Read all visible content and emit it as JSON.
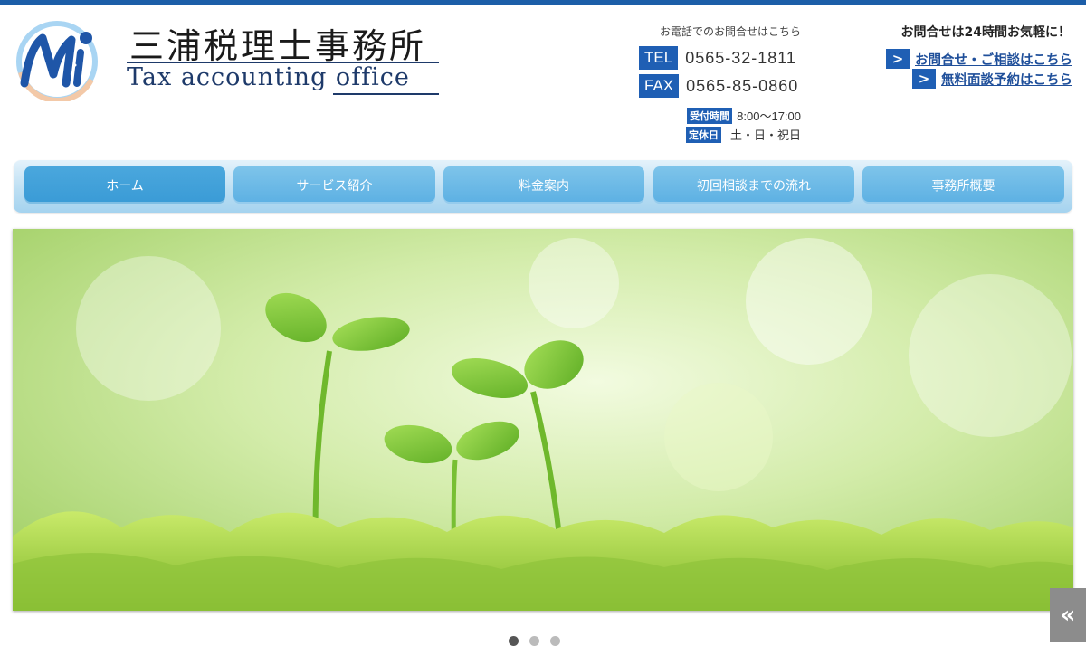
{
  "header": {
    "logo_title": "三浦税理士事務所",
    "logo_subtitle": "Tax accounting office"
  },
  "phone": {
    "caption": "お電話でのお問合せはこちら",
    "tel_label": "TEL",
    "tel_number": "0565-32-1811",
    "fax_label": "FAX",
    "fax_number": "0565-85-0860",
    "hours_label": "受付時間",
    "hours_value": "8:00〜17:00",
    "closed_label": "定休日",
    "closed_value": "土・日・祝日"
  },
  "contact": {
    "caption": "お問合せは24時間お気軽に！",
    "arrow": ">",
    "link1": "お問合せ・ご相談はこちら",
    "link2": "無料面談予約はこちら"
  },
  "nav": {
    "items": [
      {
        "label": "ホーム",
        "active": true
      },
      {
        "label": "サービス紹介"
      },
      {
        "label": "料金案内"
      },
      {
        "label": "初回相談までの流れ"
      },
      {
        "label": "事務所概要"
      }
    ]
  },
  "slider": {
    "dot_count": 3,
    "active_index": 0
  },
  "scroll_top": {
    "label": "«"
  },
  "colors": {
    "brand_blue": "#1f5fb4",
    "nav_tab": "#5cb0e3",
    "nav_tab_active": "#3a9bd6"
  }
}
